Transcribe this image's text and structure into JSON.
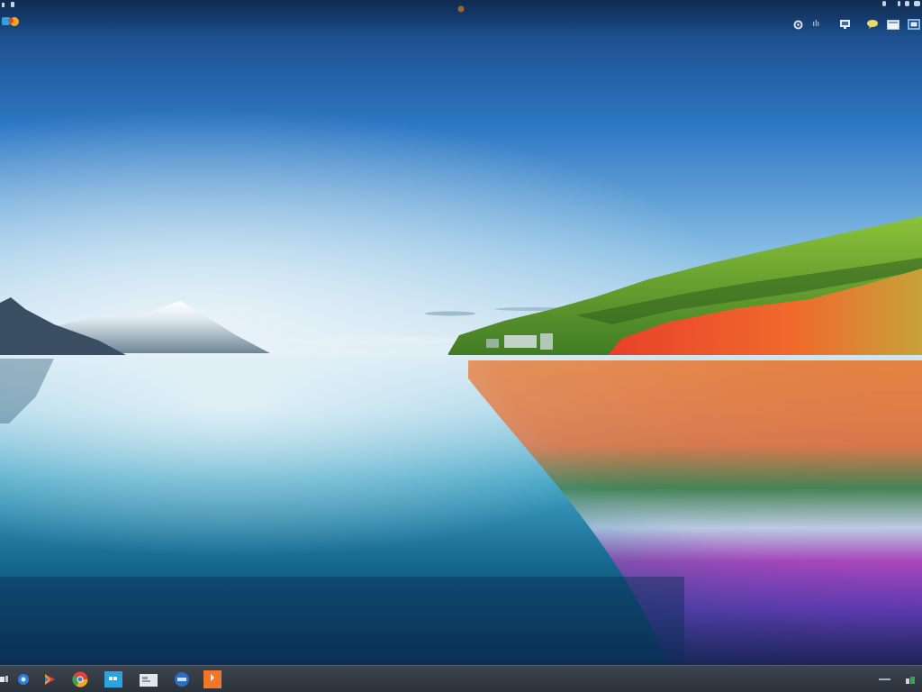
{
  "desktop": {
    "wallpaper": {
      "description_colors": {
        "sky_top": "#153f7a",
        "sky_mid": "#3f8ad0",
        "sky_horizon": "#cfe3ee",
        "water_top": "#d3e8f2",
        "water_mid": "#3ea2c4",
        "water_deep": "#0d3f66",
        "hill_green": "#5d9a2a",
        "hill_orange": "#e8542a",
        "reflection_magenta": "#d23cc4",
        "reflection_purple": "#7a2ccc"
      }
    },
    "top_bar": {
      "tray_text": "ılı",
      "tray_icons": [
        "settings-icon",
        "network-icon",
        "chat-icon",
        "window-icon",
        "display-icon"
      ]
    },
    "taskbar": {
      "icons": [
        {
          "name": "start-icon",
          "color": "#e8e8e8"
        },
        {
          "name": "browser-icon",
          "color": "#2f7fd8"
        },
        {
          "name": "media-player-icon",
          "color": "#e0433b"
        },
        {
          "name": "chrome-icon",
          "color": "#f2a81d"
        },
        {
          "name": "store-icon",
          "color": "#2aa3e0"
        },
        {
          "name": "explorer-icon",
          "color": "#e3e7ea"
        },
        {
          "name": "app-icon",
          "color": "#2b6fc4"
        },
        {
          "name": "office-icon",
          "color": "#f0762a"
        }
      ],
      "accent": "#3c4550"
    }
  }
}
